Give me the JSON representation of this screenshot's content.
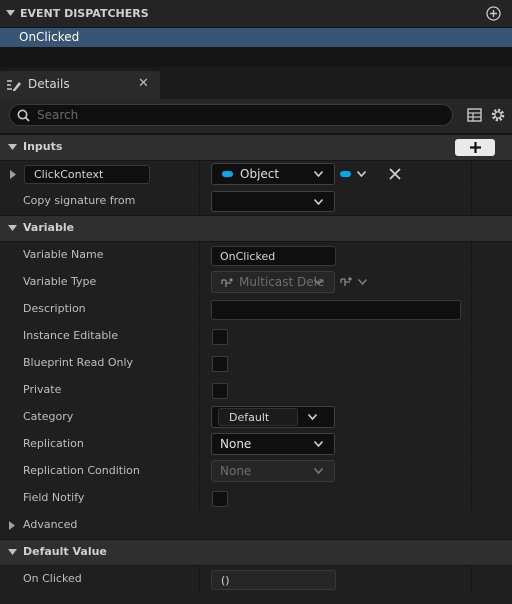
{
  "event_dispatchers": {
    "title": "EVENT DISPATCHERS",
    "selected_item": "OnClicked"
  },
  "tab": {
    "label": "Details"
  },
  "search": {
    "placeholder": "Search"
  },
  "inputs_section": {
    "title": "Inputs",
    "param_name": "ClickContext",
    "param_type": "Object",
    "copy_signature_label": "Copy signature from",
    "copy_signature_value": ""
  },
  "variable_section": {
    "title": "Variable",
    "rows": {
      "variable_name": {
        "label": "Variable Name",
        "value": "OnClicked"
      },
      "variable_type": {
        "label": "Variable Type",
        "value": "Multicast Dele"
      },
      "description": {
        "label": "Description",
        "value": ""
      },
      "instance_editable": {
        "label": "Instance Editable"
      },
      "blueprint_read_only": {
        "label": "Blueprint Read Only"
      },
      "private": {
        "label": "Private"
      },
      "category": {
        "label": "Category",
        "value": "Default"
      },
      "replication": {
        "label": "Replication",
        "value": "None"
      },
      "replication_condition": {
        "label": "Replication Condition",
        "value": "None"
      },
      "field_notify": {
        "label": "Field Notify"
      }
    },
    "advanced_label": "Advanced"
  },
  "default_value_section": {
    "title": "Default Value",
    "on_clicked_label": "On Clicked",
    "on_clicked_value": "()"
  },
  "colors": {
    "selection": "#385575",
    "object_pin": "#00a8f0",
    "panel": "#1f1f1f"
  }
}
